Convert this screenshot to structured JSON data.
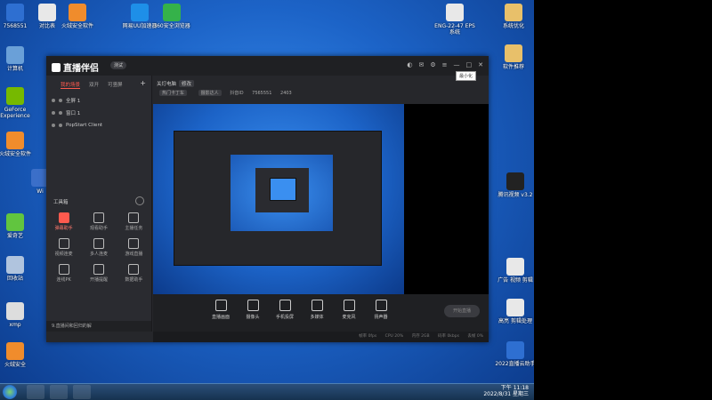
{
  "desktop": {
    "icons_left": [
      {
        "label": "7568551",
        "color": "#2e6fd1"
      },
      {
        "label": "计算机",
        "color": "#6aa0d8"
      },
      {
        "label": "GeForce Experience",
        "color": "#76b900"
      },
      {
        "label": "火绒安全软件",
        "color": "#f08c2c"
      },
      {
        "label": "Wi",
        "color": "#3b6fc9"
      },
      {
        "label": "爱奇艺",
        "color": "#61c53f"
      },
      {
        "label": "回收站",
        "color": "#b0c4de"
      },
      {
        "label": "xmp",
        "color": "#dddddd"
      },
      {
        "label": "火绒安全",
        "color": "#f08c2c"
      }
    ],
    "icons_top": [
      {
        "label": "对比表",
        "color": "#e8e8e8"
      },
      {
        "label": "火绒安全软件",
        "color": "#f08c2c"
      },
      {
        "label": "网易UU加速器",
        "color": "#1e8fe8"
      },
      {
        "label": "360安全浏览器",
        "color": "#35b24a"
      }
    ],
    "icons_right": [
      {
        "label": "ENG-22-47 EPS系统",
        "color": "#e8e8e8"
      },
      {
        "label": "系统优化",
        "color": "#e8c06a"
      },
      {
        "label": "软件推荐",
        "color": "#e8c06a"
      },
      {
        "label": "腾讯视频 v3.2",
        "color": "#222222"
      },
      {
        "label": "广告 视频 剪辑",
        "color": "#e8e8e8"
      },
      {
        "label": "高亮 剪辑处理",
        "color": "#e8e8e8"
      },
      {
        "label": "2022直播云助手",
        "color": "#2e6fd1"
      }
    ],
    "clock": {
      "time": "下午 11:18",
      "date": "2022/8/31 星期三"
    }
  },
  "app": {
    "logo": "直播伴侣",
    "version": "测试",
    "tooltip": "最小化",
    "scene_tabs": [
      "我的场景",
      "双开",
      "可竖屏"
    ],
    "sources": [
      "全屏 1",
      "窗口 1",
      "PopStart Client"
    ],
    "tools_title": "工具箱",
    "tools": [
      "弹幕助手",
      "观看助手",
      "主播任务",
      "视频连麦",
      "多人连麦",
      "游戏直播",
      "连线PK",
      "开播提醒",
      "数据助手"
    ],
    "left_footer": "9.直播间和回归的解",
    "room": {
      "title": "关灯电脑",
      "tag": "修改",
      "tags": [
        "热门卡丁车",
        "摄影达人"
      ],
      "id_label": "抖音ID",
      "id": "7565551",
      "fans": "2403"
    },
    "bottom_buttons": [
      "直播画面",
      "摄像头",
      "手机投屏",
      "多媒体",
      "麦克风",
      "扬声器"
    ],
    "live_button": "开始直播",
    "status": [
      "帧率 0fps",
      "CPU 20%",
      "内存 2GB",
      "码率 0kbps",
      "丢帧 0%"
    ]
  }
}
